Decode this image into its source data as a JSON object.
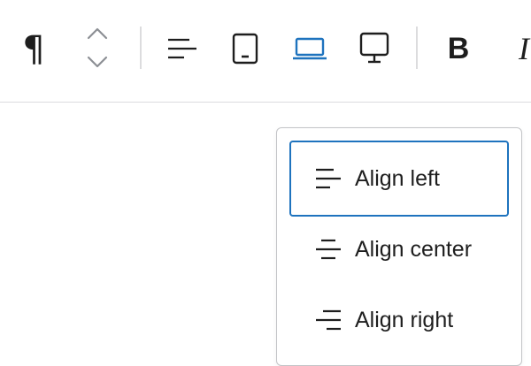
{
  "toolbar": {
    "block_type_glyph": "¶",
    "bold_label": "B",
    "italic_label": "I",
    "accent_color": "#1e73be"
  },
  "icons": {
    "block_type": "pilcrow-icon",
    "move_up": "chevron-up-icon",
    "move_down": "chevron-down-icon",
    "align": "align-left-icon",
    "tablet": "tablet-icon",
    "laptop": "laptop-icon",
    "desktop": "desktop-icon"
  },
  "align_menu": {
    "items": [
      {
        "label": "Align left",
        "icon": "align-left-icon",
        "selected": true
      },
      {
        "label": "Align center",
        "icon": "align-center-icon",
        "selected": false
      },
      {
        "label": "Align right",
        "icon": "align-right-icon",
        "selected": false
      }
    ]
  }
}
